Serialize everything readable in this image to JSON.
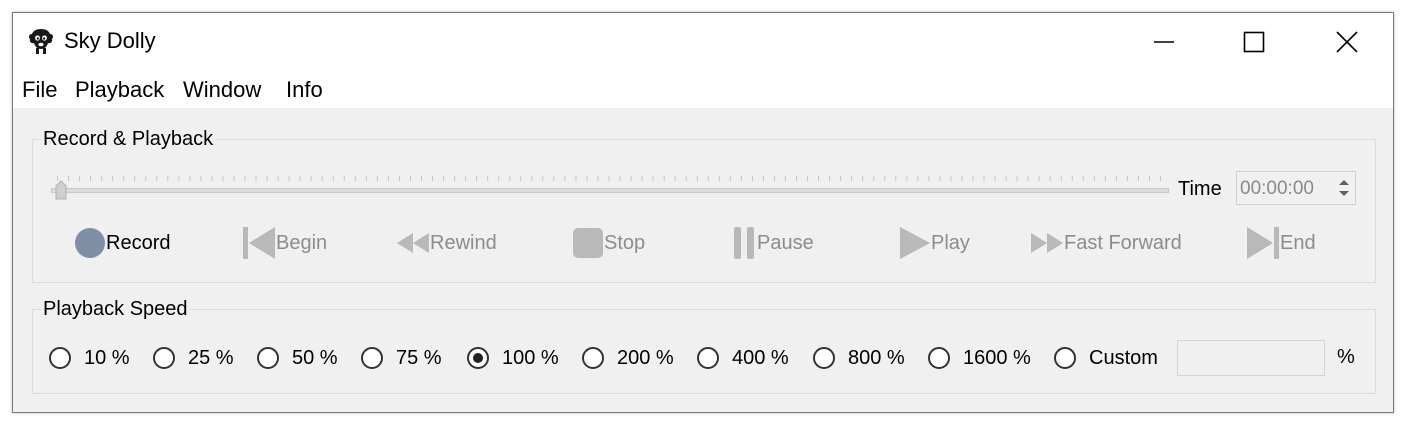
{
  "window": {
    "title": "Sky Dolly"
  },
  "menubar": {
    "items": [
      "File",
      "Playback",
      "Window",
      "Info"
    ]
  },
  "record_playback": {
    "group_title": "Record & Playback",
    "position_fraction": 0.0,
    "time_label": "Time",
    "time_value": "00:00:00",
    "controls": [
      {
        "id": "record",
        "label": "Record",
        "icon": "record-icon",
        "enabled": true
      },
      {
        "id": "begin",
        "label": "Begin",
        "icon": "skip-to-start-icon",
        "enabled": false
      },
      {
        "id": "rewind",
        "label": "Rewind",
        "icon": "rewind-icon",
        "enabled": false
      },
      {
        "id": "stop",
        "label": "Stop",
        "icon": "stop-icon",
        "enabled": false
      },
      {
        "id": "pause",
        "label": "Pause",
        "icon": "pause-icon",
        "enabled": false
      },
      {
        "id": "play",
        "label": "Play",
        "icon": "play-icon",
        "enabled": false
      },
      {
        "id": "fastforward",
        "label": "Fast Forward",
        "icon": "fast-forward-icon",
        "enabled": false
      },
      {
        "id": "end",
        "label": "End",
        "icon": "skip-to-end-icon",
        "enabled": false
      }
    ]
  },
  "playback_speed": {
    "group_title": "Playback Speed",
    "options": [
      "10 %",
      "25 %",
      "50 %",
      "75 %",
      "100 %",
      "200 %",
      "400 %",
      "800 %",
      "1600 %",
      "Custom"
    ],
    "selected": "100 %",
    "custom_value": "",
    "unit": "%"
  },
  "colors": {
    "record_dot": "#7f8fa6",
    "disabled": "#b9b9b9",
    "background": "#f0f0f0"
  }
}
